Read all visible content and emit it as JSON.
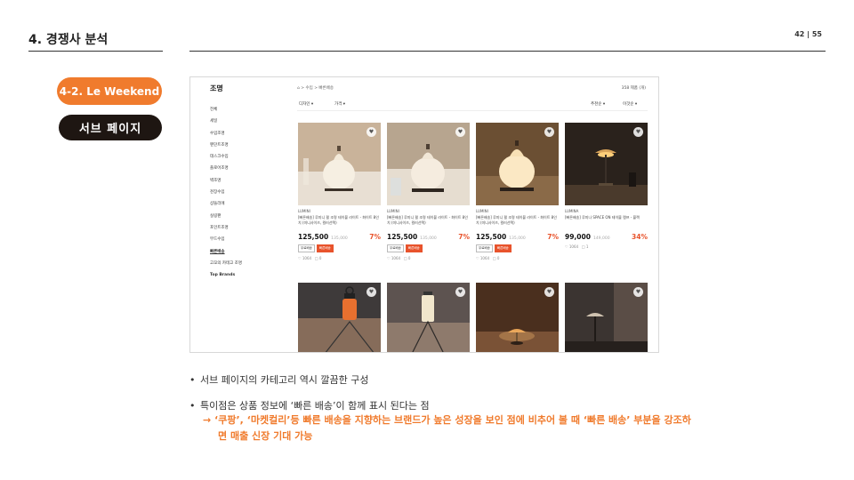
{
  "header": {
    "section_title": "4. 경쟁사 분석",
    "page_number": "42  |  55"
  },
  "labels": {
    "brand_tag": "4-2. Le Weekend",
    "page_tag": "서브 페이지"
  },
  "screenshot": {
    "sidebar": {
      "title": "조명",
      "items": [
        "전체",
        "세일",
        "수입조명",
        "펜던트조명",
        "데스크수입",
        "플로어조명",
        "벽조명",
        "천장수입",
        "샹들리에",
        "실링팬",
        "포인트조명",
        "무드수입",
        "빠른배송",
        "고꼬의 카테고 조명",
        "Top Brands"
      ],
      "active_item": "빠른배송"
    },
    "breadcrumb": "⌂  >  수입  >  빠른배송",
    "result_count": "358 제품 (개)",
    "filters": {
      "left1": "디자인  ▾",
      "left2": "가격  ▾",
      "right1": "추천순  ▾",
      "right2": "이것순  ▾"
    },
    "products": [
      {
        "brand": "LUMINI",
        "name": "[빠른배송] 루미니 펄 조명 테이블 라이트 - 화이트 8인치 (미니사이즈, 컬러선택)",
        "price": "125,500",
        "original_price": "135,000",
        "discount": "7%",
        "badge1": "무료배송",
        "badge2": "빠른배송",
        "likes": "♡ 1064",
        "reviews": "□ 0"
      },
      {
        "brand": "LUMINI",
        "name": "[빠른배송] 루미니 펄 조명 테이블 라이트 - 화이트 8인치 (미니사이즈, 컬러선택)",
        "price": "125,500",
        "original_price": "135,000",
        "discount": "7%",
        "badge1": "무료배송",
        "badge2": "빠른배송",
        "likes": "♡ 1064",
        "reviews": "□ 0"
      },
      {
        "brand": "LUMINI",
        "name": "[빠른배송] 루미니 펄 조명 테이블 라이트 - 화이트 8인치 (미니사이즈, 컬러선택)",
        "price": "125,500",
        "original_price": "135,000",
        "discount": "7%",
        "badge1": "무료배송",
        "badge2": "빠른배송",
        "likes": "♡ 1064",
        "reviews": "□ 0"
      },
      {
        "brand": "LUMINA",
        "name": "[빠른배송] 루미나 SPACE ON 테이블 램프 - 블랙",
        "price": "99,000",
        "original_price": "149,000",
        "discount": "34%",
        "badge1": "",
        "badge2": "",
        "likes": "♡ 1064",
        "reviews": "□ 1"
      }
    ]
  },
  "bullets": [
    "서브 페이지의 카테고리 역시 깔끔한 구성",
    "특이점은 상품 정보에 ‘빠른 배송’이 함께 표시 된다는 점"
  ],
  "highlight_line1": "→ ‘쿠팡’, ‘마켓컬리’등 빠른 배송을 지향하는 브랜드가 높은 성장을 보인 점에 비추어 볼 때 ‘빠른 배송’ 부분을 강조하",
  "highlight_line2": "면 매출 신장 기대 가능",
  "colors": {
    "accent": "#f07b2d",
    "dark_pill": "#1e1612",
    "discount": "#e8532c"
  }
}
